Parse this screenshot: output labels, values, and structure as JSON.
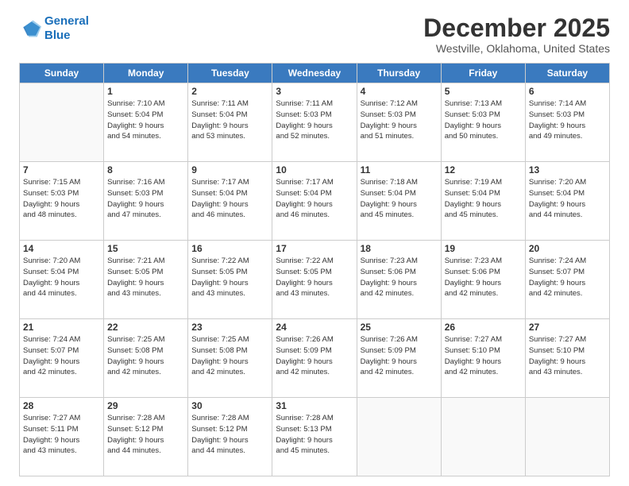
{
  "logo": {
    "line1": "General",
    "line2": "Blue"
  },
  "header": {
    "month": "December 2025",
    "location": "Westville, Oklahoma, United States"
  },
  "weekdays": [
    "Sunday",
    "Monday",
    "Tuesday",
    "Wednesday",
    "Thursday",
    "Friday",
    "Saturday"
  ],
  "weeks": [
    [
      {
        "day": "",
        "info": ""
      },
      {
        "day": "1",
        "info": "Sunrise: 7:10 AM\nSunset: 5:04 PM\nDaylight: 9 hours\nand 54 minutes."
      },
      {
        "day": "2",
        "info": "Sunrise: 7:11 AM\nSunset: 5:04 PM\nDaylight: 9 hours\nand 53 minutes."
      },
      {
        "day": "3",
        "info": "Sunrise: 7:11 AM\nSunset: 5:03 PM\nDaylight: 9 hours\nand 52 minutes."
      },
      {
        "day": "4",
        "info": "Sunrise: 7:12 AM\nSunset: 5:03 PM\nDaylight: 9 hours\nand 51 minutes."
      },
      {
        "day": "5",
        "info": "Sunrise: 7:13 AM\nSunset: 5:03 PM\nDaylight: 9 hours\nand 50 minutes."
      },
      {
        "day": "6",
        "info": "Sunrise: 7:14 AM\nSunset: 5:03 PM\nDaylight: 9 hours\nand 49 minutes."
      }
    ],
    [
      {
        "day": "7",
        "info": "Sunrise: 7:15 AM\nSunset: 5:03 PM\nDaylight: 9 hours\nand 48 minutes."
      },
      {
        "day": "8",
        "info": "Sunrise: 7:16 AM\nSunset: 5:03 PM\nDaylight: 9 hours\nand 47 minutes."
      },
      {
        "day": "9",
        "info": "Sunrise: 7:17 AM\nSunset: 5:04 PM\nDaylight: 9 hours\nand 46 minutes."
      },
      {
        "day": "10",
        "info": "Sunrise: 7:17 AM\nSunset: 5:04 PM\nDaylight: 9 hours\nand 46 minutes."
      },
      {
        "day": "11",
        "info": "Sunrise: 7:18 AM\nSunset: 5:04 PM\nDaylight: 9 hours\nand 45 minutes."
      },
      {
        "day": "12",
        "info": "Sunrise: 7:19 AM\nSunset: 5:04 PM\nDaylight: 9 hours\nand 45 minutes."
      },
      {
        "day": "13",
        "info": "Sunrise: 7:20 AM\nSunset: 5:04 PM\nDaylight: 9 hours\nand 44 minutes."
      }
    ],
    [
      {
        "day": "14",
        "info": "Sunrise: 7:20 AM\nSunset: 5:04 PM\nDaylight: 9 hours\nand 44 minutes."
      },
      {
        "day": "15",
        "info": "Sunrise: 7:21 AM\nSunset: 5:05 PM\nDaylight: 9 hours\nand 43 minutes."
      },
      {
        "day": "16",
        "info": "Sunrise: 7:22 AM\nSunset: 5:05 PM\nDaylight: 9 hours\nand 43 minutes."
      },
      {
        "day": "17",
        "info": "Sunrise: 7:22 AM\nSunset: 5:05 PM\nDaylight: 9 hours\nand 43 minutes."
      },
      {
        "day": "18",
        "info": "Sunrise: 7:23 AM\nSunset: 5:06 PM\nDaylight: 9 hours\nand 42 minutes."
      },
      {
        "day": "19",
        "info": "Sunrise: 7:23 AM\nSunset: 5:06 PM\nDaylight: 9 hours\nand 42 minutes."
      },
      {
        "day": "20",
        "info": "Sunrise: 7:24 AM\nSunset: 5:07 PM\nDaylight: 9 hours\nand 42 minutes."
      }
    ],
    [
      {
        "day": "21",
        "info": "Sunrise: 7:24 AM\nSunset: 5:07 PM\nDaylight: 9 hours\nand 42 minutes."
      },
      {
        "day": "22",
        "info": "Sunrise: 7:25 AM\nSunset: 5:08 PM\nDaylight: 9 hours\nand 42 minutes."
      },
      {
        "day": "23",
        "info": "Sunrise: 7:25 AM\nSunset: 5:08 PM\nDaylight: 9 hours\nand 42 minutes."
      },
      {
        "day": "24",
        "info": "Sunrise: 7:26 AM\nSunset: 5:09 PM\nDaylight: 9 hours\nand 42 minutes."
      },
      {
        "day": "25",
        "info": "Sunrise: 7:26 AM\nSunset: 5:09 PM\nDaylight: 9 hours\nand 42 minutes."
      },
      {
        "day": "26",
        "info": "Sunrise: 7:27 AM\nSunset: 5:10 PM\nDaylight: 9 hours\nand 42 minutes."
      },
      {
        "day": "27",
        "info": "Sunrise: 7:27 AM\nSunset: 5:10 PM\nDaylight: 9 hours\nand 43 minutes."
      }
    ],
    [
      {
        "day": "28",
        "info": "Sunrise: 7:27 AM\nSunset: 5:11 PM\nDaylight: 9 hours\nand 43 minutes."
      },
      {
        "day": "29",
        "info": "Sunrise: 7:28 AM\nSunset: 5:12 PM\nDaylight: 9 hours\nand 44 minutes."
      },
      {
        "day": "30",
        "info": "Sunrise: 7:28 AM\nSunset: 5:12 PM\nDaylight: 9 hours\nand 44 minutes."
      },
      {
        "day": "31",
        "info": "Sunrise: 7:28 AM\nSunset: 5:13 PM\nDaylight: 9 hours\nand 45 minutes."
      },
      {
        "day": "",
        "info": ""
      },
      {
        "day": "",
        "info": ""
      },
      {
        "day": "",
        "info": ""
      }
    ]
  ]
}
